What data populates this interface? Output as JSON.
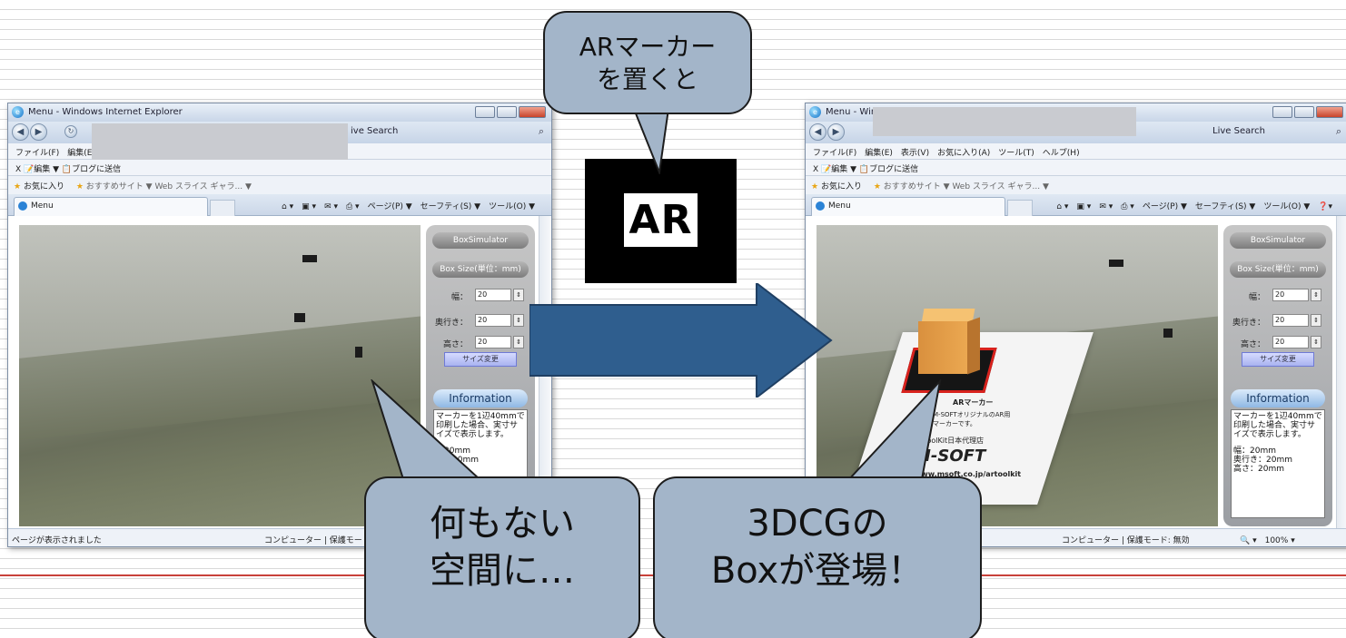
{
  "left_window": {
    "title": "Menu - Windows Internet Explorer",
    "search": "ive Search",
    "menu": "ファイル(F)　編集(E",
    "links": "X 📝編集 ▼ 📋ブログに送信",
    "favorites": "お気に入り",
    "fav_links": "おすすめサイト ▼  Web スライス ギャラ... ▼",
    "tab": "Menu",
    "commands": "ページ(P) ▼　セーフティ(S) ▼　ツール(O) ▼",
    "status": "ページが表示されました",
    "status_zone": "コンピューター | 保護モー"
  },
  "right_window": {
    "title": "Menu - Windc",
    "search": "Live Search",
    "menu": "ファイル(F)　編集(E)　表示(V)　お気に入り(A)　ツール(T)　ヘルプ(H)",
    "links": "X 📝編集 ▼ 📋ブログに送信",
    "favorites": "お気に入り",
    "fav_links": "おすすめサイト ▼  Web スライス ギャラ... ▼",
    "tab": "Menu",
    "commands": "ページ(P) ▼　セーフティ(S) ▼　ツール(O) ▼",
    "status_zone": "コンピューター | 保護モード: 無効",
    "zoom": "100%"
  },
  "app": {
    "title": "BoxSimulator",
    "box_size": "Box Size(単位：mm)",
    "width_label": "幅：",
    "depth_label": "奥行き：",
    "height_label": "高さ：",
    "width_val": "20",
    "depth_val": "20",
    "height_val": "20",
    "apply": "サイズ変更",
    "info": "Information",
    "info_text": "マーカーを1辺40mmで印刷した場合、実寸サイズで表示します。",
    "info_w": "幅：20mm",
    "info_d": "奥行き：20mm",
    "info_h": "高さ：20mm",
    "info_w_partial": "：20mm",
    "info_d_partial": "き：20mm",
    "info_h_partial": "0mm"
  },
  "marker_sheet": {
    "line1": "ARマーカー",
    "line2": "M-SOFTオリジナルのAR用",
    "line3": "マーカーです。",
    "line4": "ToolKit日本代理店",
    "brand": "M-SOFT",
    "url": "www.msoft.co.jp/artoolkit"
  },
  "ar_marker": {
    "text": "AR"
  },
  "callouts": {
    "top_l1": "ARマーカー",
    "top_l2": "を置くと",
    "left_l1": "何もない",
    "left_l2": "空間に…",
    "right_l1": "3DCGの",
    "right_l2": "Boxが登場！"
  }
}
